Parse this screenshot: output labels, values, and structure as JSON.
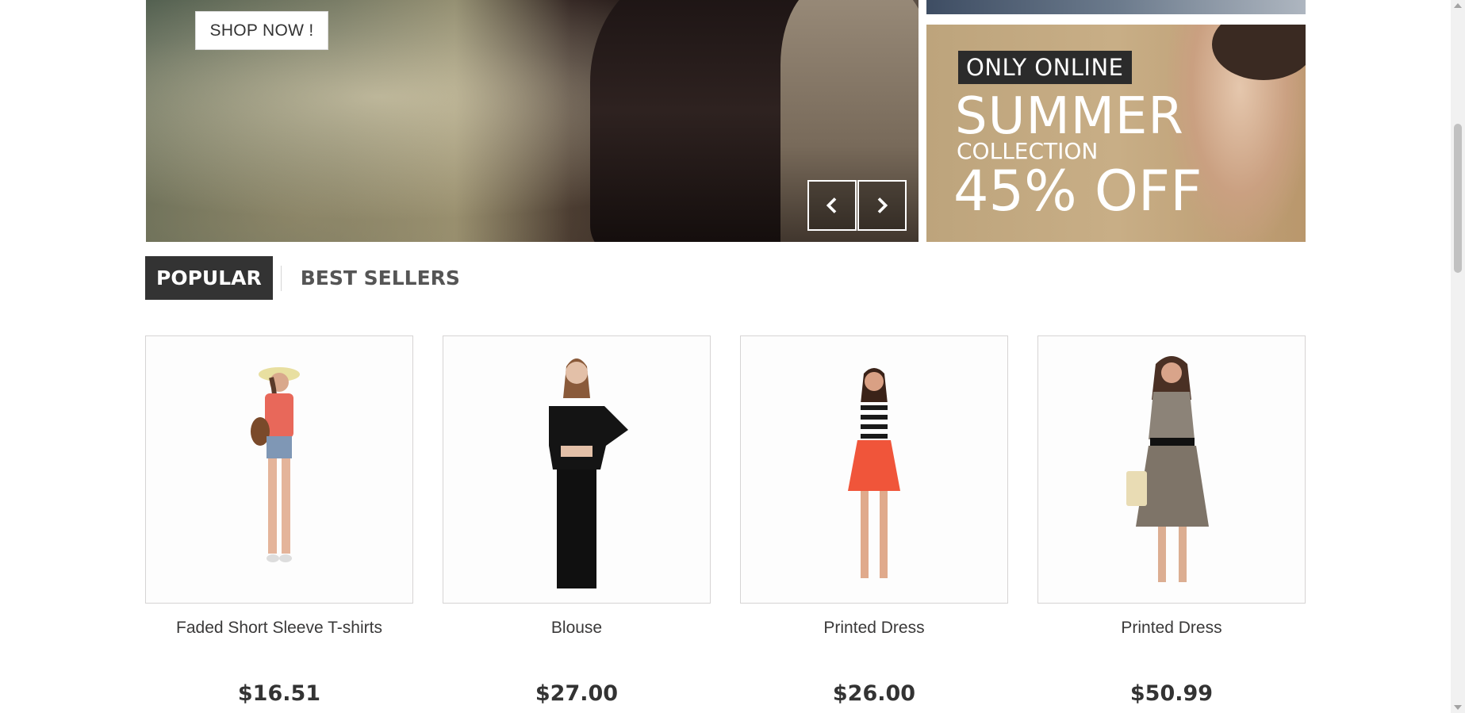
{
  "slider": {
    "shop_now_label": "SHOP NOW !",
    "prev_icon": "chevron-left-icon",
    "next_icon": "chevron-right-icon"
  },
  "promo_banner": {
    "badge": "ONLY ONLINE",
    "title": "SUMMER",
    "subtitle": "COLLECTION",
    "discount": "45% OFF"
  },
  "tabs": [
    {
      "label": "POPULAR",
      "active": true
    },
    {
      "label": "BEST SELLERS",
      "active": false
    }
  ],
  "products": [
    {
      "name": "Faded Short Sleeve T-shirts",
      "price": "$16.51"
    },
    {
      "name": "Blouse",
      "price": "$27.00"
    },
    {
      "name": "Printed Dress",
      "price": "$26.00"
    },
    {
      "name": "Printed Dress",
      "price": "$50.99"
    }
  ],
  "colors": {
    "tab_active_bg": "#333333",
    "text_dark": "#333333",
    "product_border": "#d6d4d4"
  }
}
